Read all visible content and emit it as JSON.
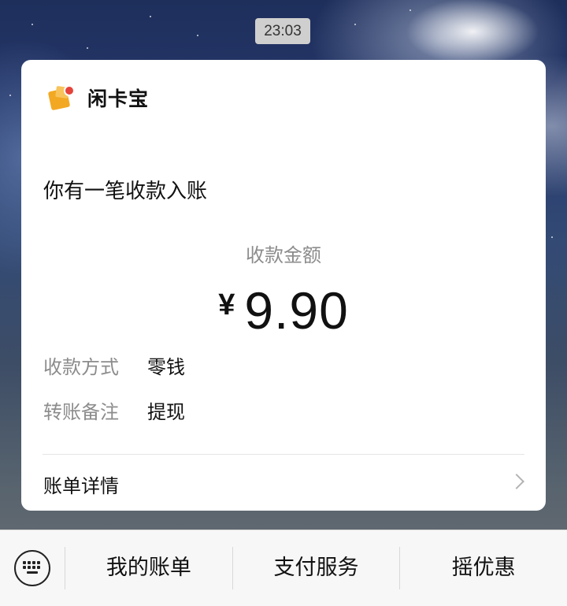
{
  "status": {
    "time": "23:03"
  },
  "card": {
    "app_name": "闲卡宝",
    "notice_title": "你有一笔收款入账",
    "amount_label": "收款金额",
    "currency_symbol": "¥",
    "amount": "9.90",
    "details": [
      {
        "key": "收款方式",
        "value": "零钱"
      },
      {
        "key": "转账备注",
        "value": "提现"
      }
    ],
    "bill_detail_label": "账单详情"
  },
  "bottom_menu": {
    "keyboard_icon": "keyboard-icon",
    "items": [
      {
        "label": "我的账单"
      },
      {
        "label": "支付服务"
      },
      {
        "label": "摇优惠"
      }
    ]
  },
  "colors": {
    "logo_orange": "#f3a823",
    "logo_badge": "#e5433a",
    "muted_text": "#8c8c8c"
  }
}
